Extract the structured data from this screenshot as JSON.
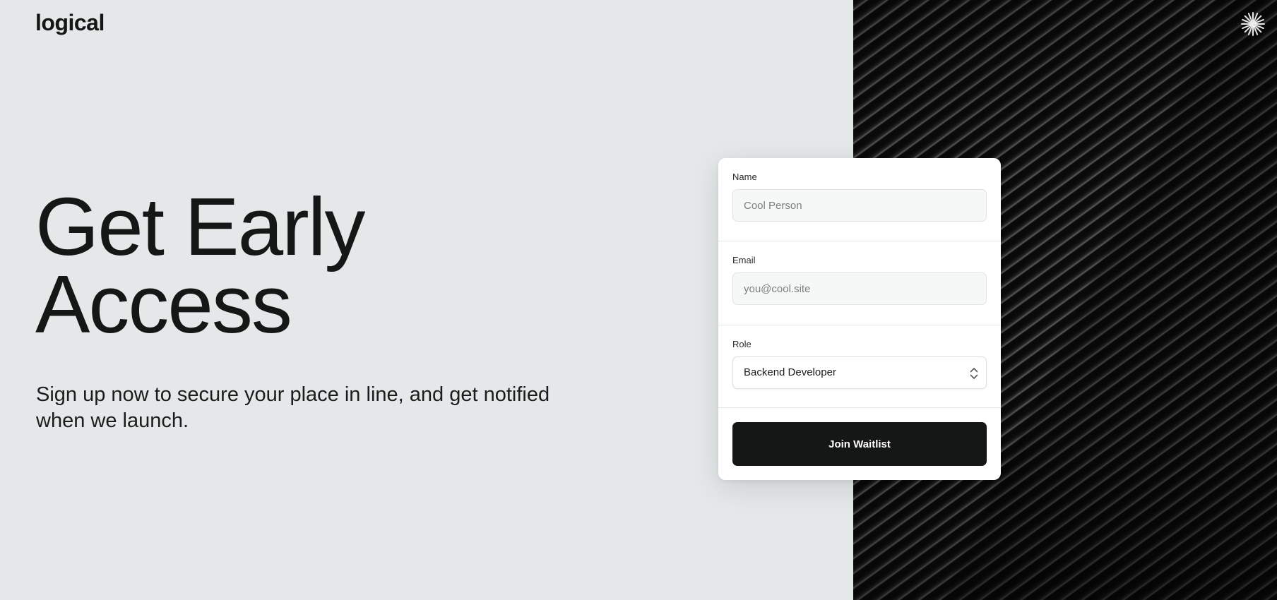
{
  "brand": {
    "logo_text": "logical"
  },
  "hero": {
    "headline_line1": "Get Early",
    "headline_line2": "Access",
    "subtitle": "Sign up now to secure your place in line, and get notified when we launch."
  },
  "form": {
    "name": {
      "label": "Name",
      "placeholder": "Cool Person",
      "value": ""
    },
    "email": {
      "label": "Email",
      "placeholder": "you@cool.site",
      "value": ""
    },
    "role": {
      "label": "Role",
      "selected": "Backend Developer"
    },
    "submit_label": "Join Waitlist"
  },
  "icons": {
    "corner": "sparkle-icon",
    "select": "chevron-up-down-icon"
  },
  "colors": {
    "background": "#e4e8e9",
    "text": "#151616",
    "button": "#151616",
    "card": "#ffffff"
  }
}
